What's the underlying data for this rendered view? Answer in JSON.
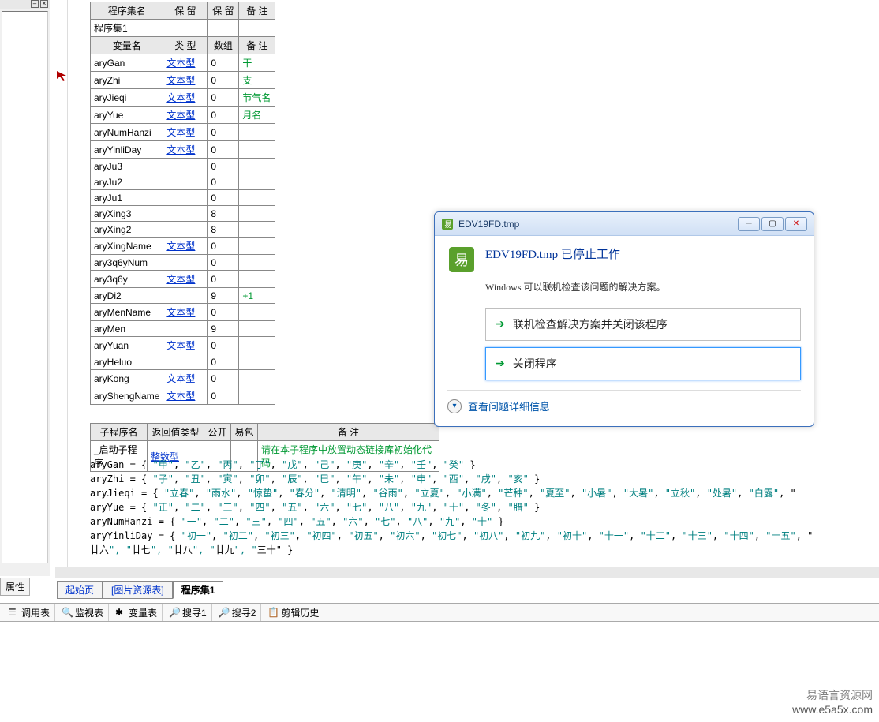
{
  "left_panel": {
    "props_tab": "属性"
  },
  "var_table": {
    "header1": [
      "程序集名",
      "保 留",
      "保 留",
      "备 注"
    ],
    "row1": "程序集1",
    "header2": [
      "变量名",
      "类 型",
      "数组",
      "备 注"
    ],
    "rows": [
      {
        "name": "aryGan",
        "type": "文本型",
        "arr": "0",
        "note": "干"
      },
      {
        "name": "aryZhi",
        "type": "文本型",
        "arr": "0",
        "note": "支"
      },
      {
        "name": "aryJieqi",
        "type": "文本型",
        "arr": "0",
        "note": "节气名"
      },
      {
        "name": "aryYue",
        "type": "文本型",
        "arr": "0",
        "note": "月名"
      },
      {
        "name": "aryNumHanzi",
        "type": "文本型",
        "arr": "0",
        "note": ""
      },
      {
        "name": "aryYinliDay",
        "type": "文本型",
        "arr": "0",
        "note": ""
      },
      {
        "name": "aryJu3",
        "type": "",
        "arr": "0",
        "note": ""
      },
      {
        "name": "aryJu2",
        "type": "",
        "arr": "0",
        "note": ""
      },
      {
        "name": "aryJu1",
        "type": "",
        "arr": "0",
        "note": ""
      },
      {
        "name": "aryXing3",
        "type": "",
        "arr": "8",
        "note": ""
      },
      {
        "name": "aryXing2",
        "type": "",
        "arr": "8",
        "note": ""
      },
      {
        "name": "aryXingName",
        "type": "文本型",
        "arr": "0",
        "note": ""
      },
      {
        "name": "ary3q6yNum",
        "type": "",
        "arr": "0",
        "note": ""
      },
      {
        "name": "ary3q6y",
        "type": "文本型",
        "arr": "0",
        "note": ""
      },
      {
        "name": "aryDi2",
        "type": "",
        "arr": "9",
        "note": "+1"
      },
      {
        "name": "aryMenName",
        "type": "文本型",
        "arr": "0",
        "note": ""
      },
      {
        "name": "aryMen",
        "type": "",
        "arr": "9",
        "note": ""
      },
      {
        "name": "aryYuan",
        "type": "文本型",
        "arr": "0",
        "note": ""
      },
      {
        "name": "aryHeluo",
        "type": "",
        "arr": "0",
        "note": ""
      },
      {
        "name": "aryKong",
        "type": "文本型",
        "arr": "0",
        "note": ""
      },
      {
        "name": "aryShengName",
        "type": "文本型",
        "arr": "0",
        "note": ""
      }
    ]
  },
  "sub_table": {
    "headers": [
      "子程序名",
      "返回值类型",
      "公开",
      "易包",
      "备 注"
    ],
    "row": {
      "name": "_启动子程序",
      "type": "整数型",
      "pub": "",
      "pkg": "",
      "note": "请在本子程序中放置动态链接库初始化代码"
    }
  },
  "code": {
    "l1a": "aryGan = { ",
    "l1b": "\"甲\"",
    "l1c": ", ",
    "l1d": "\"乙\"",
    "l1e": ", ",
    "l1f": "\"丙\"",
    "l1g": ", ",
    "l1h": "\"丁\"",
    "l1i": ", ",
    "l1j": "\"戊\"",
    "l1k": ", ",
    "l1l": "\"己\"",
    "l1m": ", ",
    "l1n": "\"庚\"",
    "l1o": ", ",
    "l1p": "\"辛\"",
    "l1q": ", ",
    "l1r": "\"壬\"",
    "l1s": ", ",
    "l1t": "\"癸\"",
    "l1u": " }",
    "l2": "aryZhi = { \"子\", \"丑\", \"寅\", \"卯\", \"辰\", \"巳\", \"午\", \"未\", \"申\", \"酉\", \"戌\", \"亥\" }",
    "l3": "aryJieqi = { \"立春\", \"雨水\", \"惊蛰\", \"春分\", \"清明\", \"谷雨\", \"立夏\", \"小满\", \"芒种\", \"夏至\", \"小暑\", \"大暑\", \"立秋\", \"处暑\", \"白露\", \"",
    "l4": "aryYue = { \"正\", \"二\", \"三\", \"四\", \"五\", \"六\", \"七\", \"八\", \"九\", \"十\", \"冬\", \"腊\" }",
    "l5": "aryNumHanzi = { \"一\", \"二\", \"三\", \"四\", \"五\", \"六\", \"七\", \"八\", \"九\", \"十\" }",
    "l6": "aryYinliDay = { \"初一\", \"初二\", \"初三\", \"初四\", \"初五\", \"初六\", \"初七\", \"初八\", \"初九\", \"初十\", \"十一\", \"十二\", \"十三\", \"十四\", \"十五\", \"",
    "l7": "廿六\", \"廿七\", \"廿八\", \"廿九\", \"三十\" }"
  },
  "tabs": {
    "start": "起始页",
    "img": "[图片资源表]",
    "prog": "程序集1"
  },
  "toolbar": {
    "debug": "调用表",
    "watch": "监视表",
    "vars": "变量表",
    "search1": "搜寻1",
    "search2": "搜寻2",
    "clip": "剪辑历史"
  },
  "dialog": {
    "title": "EDV19FD.tmp",
    "heading": "EDV19FD.tmp 已停止工作",
    "subtext": "Windows 可以联机检查该问题的解决方案。",
    "action1": "联机检查解决方案并关闭该程序",
    "action2": "关闭程序",
    "footer": "查看问题详细信息"
  },
  "watermark": {
    "line1": "易语言资源网",
    "line2": "www.e5a5x.com"
  }
}
